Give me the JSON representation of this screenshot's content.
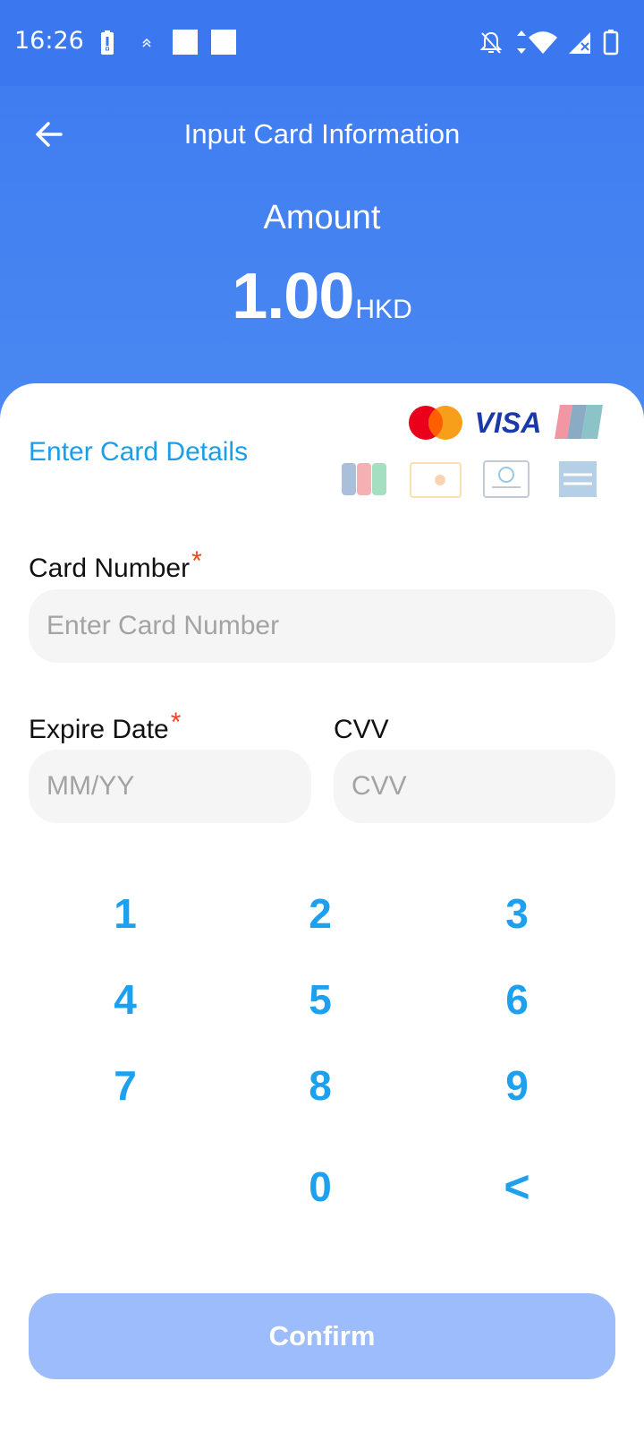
{
  "status_bar": {
    "time": "16:26"
  },
  "header": {
    "title": "Input Card Information"
  },
  "amount": {
    "label": "Amount",
    "value": "1.00",
    "currency": "HKD"
  },
  "card_section": {
    "heading": "Enter Card Details",
    "logos": [
      "Mastercard",
      "VISA",
      "UnionPay",
      "JCB",
      "Discover",
      "Diners Club",
      "American Express"
    ]
  },
  "form": {
    "card_number": {
      "label": "Card Number",
      "required_mark": "*",
      "placeholder": "Enter Card Number",
      "value": ""
    },
    "expire_date": {
      "label": "Expire Date",
      "required_mark": "*",
      "placeholder": "MM/YY",
      "value": ""
    },
    "cvv": {
      "label": "CVV",
      "placeholder": "CVV",
      "value": ""
    }
  },
  "keypad": {
    "keys": [
      "1",
      "2",
      "3",
      "4",
      "5",
      "6",
      "7",
      "8",
      "9",
      "0",
      "<"
    ]
  },
  "confirm_button": {
    "label": "Confirm"
  },
  "colors": {
    "primary": "#3d7af0",
    "accent": "#1da0ee",
    "confirm_disabled": "#9dbcfb",
    "required": "#e8471f"
  }
}
